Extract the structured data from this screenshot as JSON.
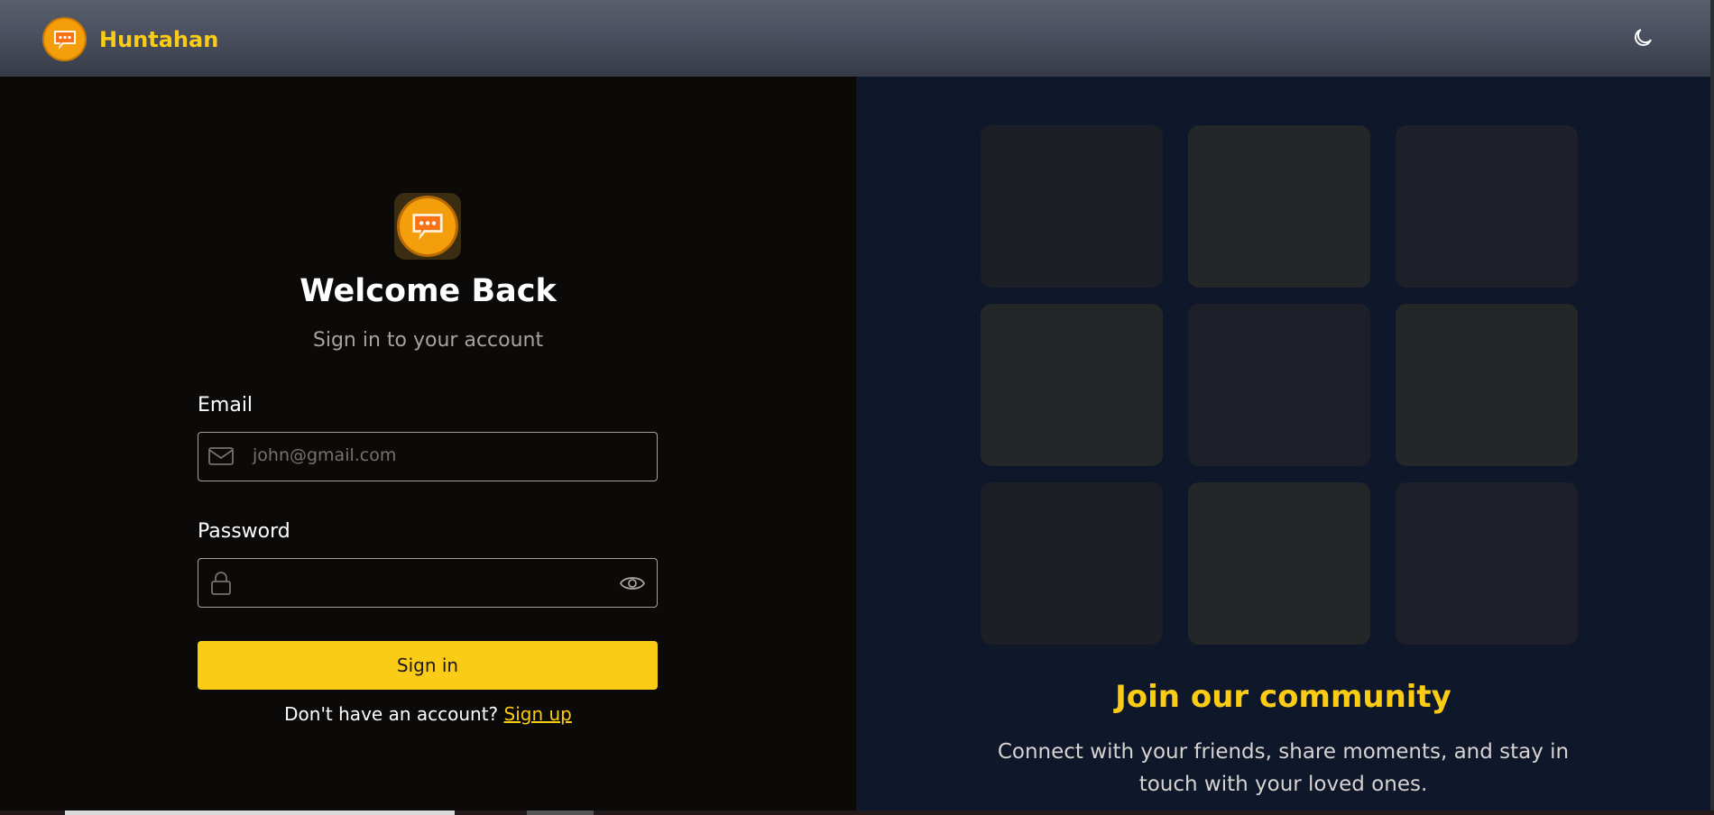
{
  "header": {
    "brand_name": "Huntahan",
    "brand_icon": "chat-bubble-icon",
    "theme_icon": "moon-icon"
  },
  "login": {
    "title": "Welcome Back",
    "subtitle": "Sign in to your account",
    "email_label": "Email",
    "email_placeholder": "john@gmail.com",
    "email_icon": "mail-icon",
    "password_label": "Password",
    "password_placeholder": "",
    "password_icon": "lock-icon",
    "reveal_icon": "eye-icon",
    "submit_label": "Sign in",
    "no_account_text": "Don't have an account?",
    "signup_link": "Sign up"
  },
  "community": {
    "title": "Join our community",
    "description": "Connect with your friends, share moments, and stay in touch with your loved ones.",
    "tiles": 9
  },
  "colors": {
    "accent": "#facc15",
    "left_bg": "#0c0a09",
    "right_bg": "#0f172a"
  }
}
